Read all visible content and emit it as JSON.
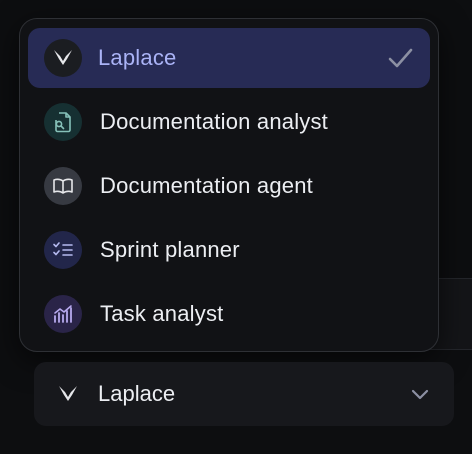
{
  "dropdown": {
    "items": [
      {
        "label": "Laplace",
        "icon": "laplace-logo-icon",
        "selected": true
      },
      {
        "label": "Documentation analyst",
        "icon": "document-search-icon",
        "selected": false
      },
      {
        "label": "Documentation agent",
        "icon": "open-book-icon",
        "selected": false
      },
      {
        "label": "Sprint planner",
        "icon": "checklist-icon",
        "selected": false
      },
      {
        "label": "Task analyst",
        "icon": "chart-trend-icon",
        "selected": false
      }
    ]
  },
  "select": {
    "value": "Laplace",
    "icon": "laplace-logo-icon"
  },
  "colors": {
    "accent": "#aab3f6",
    "selected_bg": "#272b55"
  }
}
